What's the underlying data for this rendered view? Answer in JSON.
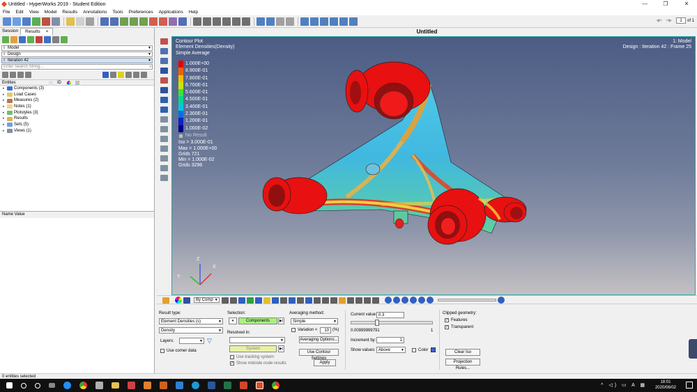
{
  "app": {
    "title": "Untitled - HyperWorks 2019 - Student Edition",
    "win_min": "—",
    "win_max": "❐",
    "win_close": "✕"
  },
  "menu": [
    "File",
    "Edit",
    "View",
    "Model",
    "Results",
    "Annotations",
    "Tools",
    "Preferences",
    "Applications",
    "Help"
  ],
  "page": {
    "current": "1",
    "of": "of 1"
  },
  "left": {
    "tab_session": "Session",
    "tab_results": "Results",
    "tab_close": "×",
    "dd1": "Model",
    "dd2": "Design",
    "dd3": "Iteration 42",
    "search_placeholder": "Enter Search String...",
    "entities_label": "Entities",
    "id_label": "ID",
    "tree": [
      {
        "label": "Components (3)",
        "color": "#3a6fd8"
      },
      {
        "label": "Load Cases",
        "color": "#e8c860"
      },
      {
        "label": "Measures (2)",
        "color": "#c07050"
      },
      {
        "label": "Notes (1)",
        "color": "#e8d890"
      },
      {
        "label": "Plotstyles (3)",
        "color": "#6cc070"
      },
      {
        "label": "Results",
        "color": "#e0b050"
      },
      {
        "label": "Sets (5)",
        "color": "#70a0e0"
      },
      {
        "label": "Views (1)",
        "color": "#8090a0"
      }
    ],
    "name_value": "Name Value"
  },
  "view": {
    "title": "Untitled",
    "plot_title": "Contour Plot",
    "plot_sub": "Element Densities(Density)",
    "plot_avg": "Simple Average",
    "model_label": "1: Model",
    "frame_label": "Design : Iteration 42 : Frame 25",
    "legend": [
      {
        "v": "1.000E+00",
        "c": "#e80000"
      },
      {
        "v": "8.900E-01",
        "c": "#f06000"
      },
      {
        "v": "7.800E-01",
        "c": "#f0c000"
      },
      {
        "v": "6.700E-01",
        "c": "#c8e800"
      },
      {
        "v": "5.600E-01",
        "c": "#40e040"
      },
      {
        "v": "4.500E-01",
        "c": "#00d890"
      },
      {
        "v": "3.400E-01",
        "c": "#00c8e0"
      },
      {
        "v": "2.300E-01",
        "c": "#0070e8"
      },
      {
        "v": "1.200E-01",
        "c": "#1020c8"
      },
      {
        "v": "1.000E-02",
        "c": "#000088"
      }
    ],
    "no_result": "No Result",
    "stats": [
      "Iso > 3.000E-01",
      "Max = 1.000E+00",
      "Grids 721",
      "Min = 1.000E-02",
      "Grids 3296"
    ],
    "axes": {
      "x": "X",
      "y": "Y",
      "z": "Z"
    }
  },
  "bottom": {
    "bycomp": "By Comp"
  },
  "panel": {
    "result_type_label": "Result type:",
    "result_type": "Element Densities (s)",
    "density": "Density",
    "layers": "Layers:",
    "use_corner": "Use corner data",
    "selection_label": "Selection:",
    "components_btn": "Components",
    "resolved_in": "Resolved in:",
    "system_btn": "System",
    "use_tracking": "Use tracking system",
    "show_midside": "Show midside node results",
    "avg_method": "Averaging method:",
    "avg_value": "Simple",
    "variation": "Variation <",
    "variation_val": "10",
    "pct": "(%)",
    "avg_options": "Averaging Options...",
    "use_contour": "Use Contour Settings",
    "apply": "Apply",
    "current_value_label": "Current value:",
    "current_value": "0.3",
    "slider_min": "0.00999999791",
    "slider_max": "1",
    "increment_label": "Increment by:",
    "increment": "1",
    "show_values_label": "Show values:",
    "show_values": "Above",
    "color_label": "Color",
    "clipped": "Clipped geometry:",
    "features": "Features",
    "transparent": "Transparent",
    "clear_iso": "Clear Iso",
    "projection": "Projection Rules..."
  },
  "status": "0 entities selected",
  "tray": {
    "time": "18:01",
    "date": "2020/06/02"
  }
}
